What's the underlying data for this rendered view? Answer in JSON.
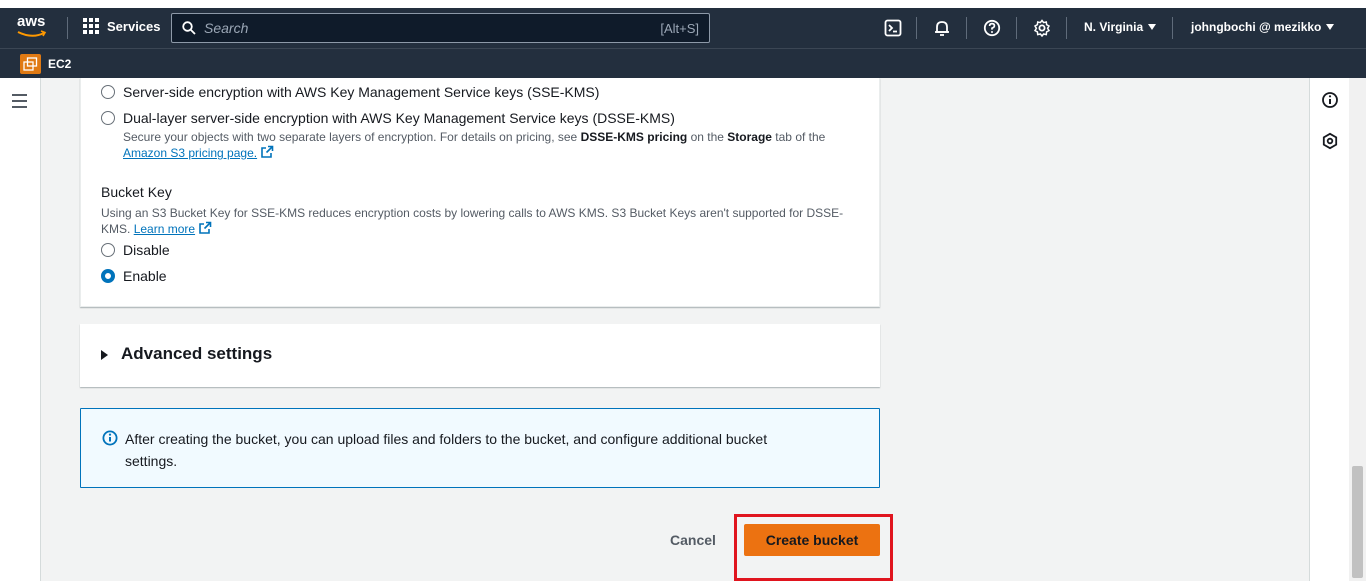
{
  "topnav": {
    "logo_text": "aws",
    "services_label": "Services",
    "search_placeholder": "Search",
    "search_hint": "[Alt+S]",
    "icons": [
      "cloudshell-icon",
      "bell-icon",
      "help-icon",
      "settings-icon"
    ],
    "region": "N. Virginia",
    "user": "johngbochi @ mezikko"
  },
  "subnav": {
    "service_label": "EC2"
  },
  "encryption": {
    "option_sse_kms": "Server-side encryption with AWS Key Management Service keys (SSE-KMS)",
    "option_dsse_kms": "Dual-layer server-side encryption with AWS Key Management Service keys (DSSE-KMS)",
    "dsse_desc_prefix": "Secure your objects with two separate layers of encryption. For details on pricing, see ",
    "dsse_desc_bold1": "DSSE-KMS pricing",
    "dsse_desc_mid": " on the ",
    "dsse_desc_bold2": "Storage",
    "dsse_desc_suffix": " tab of the",
    "dsse_link": "Amazon S3 pricing page."
  },
  "bucket_key": {
    "title": "Bucket Key",
    "desc": "Using an S3 Bucket Key for SSE-KMS reduces encryption costs by lowering calls to AWS KMS. S3 Bucket Keys aren't supported for DSSE-KMS.",
    "learn_more": "Learn more",
    "option_disable": "Disable",
    "option_enable": "Enable",
    "selected": "Enable"
  },
  "advanced": {
    "title": "Advanced settings"
  },
  "info": {
    "message": "After creating the bucket, you can upload files and folders to the bucket, and configure additional bucket settings."
  },
  "actions": {
    "cancel_label": "Cancel",
    "create_label": "Create bucket"
  },
  "colors": {
    "nav_bg": "#232f3e",
    "primary_button": "#ec7211",
    "link": "#0073bb",
    "highlight": "#e0141e"
  }
}
